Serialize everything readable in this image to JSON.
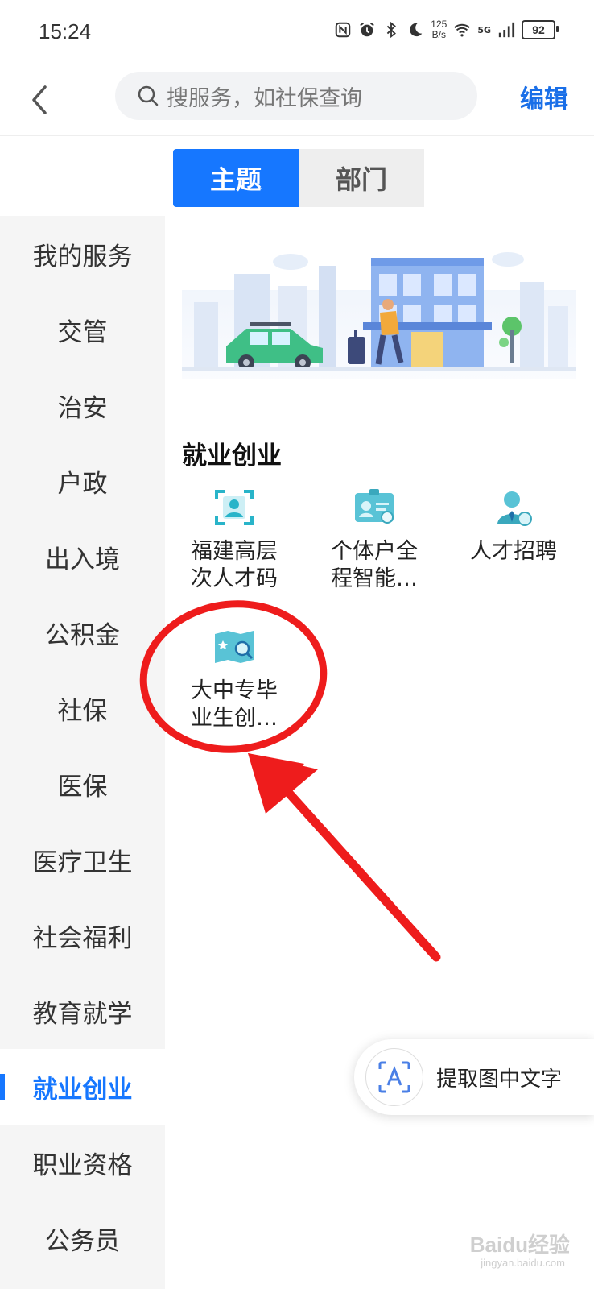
{
  "status_bar": {
    "time": "15:24",
    "speed_value": "125",
    "speed_unit": "B/s",
    "network": "5G",
    "battery": "92",
    "icons": [
      "nfc-icon",
      "alarm-icon",
      "bluetooth-icon",
      "moon-icon",
      "wifi-icon",
      "signal-icon",
      "battery-icon"
    ]
  },
  "header": {
    "back_icon": "chevron-left-icon",
    "search_placeholder": "搜服务，如社保查询",
    "edit_label": "编辑"
  },
  "tabs": [
    {
      "label": "主题",
      "active": true
    },
    {
      "label": "部门",
      "active": false
    }
  ],
  "sidebar": {
    "items": [
      {
        "label": "我的服务",
        "active": false
      },
      {
        "label": "交管",
        "active": false
      },
      {
        "label": "治安",
        "active": false
      },
      {
        "label": "户政",
        "active": false
      },
      {
        "label": "出入境",
        "active": false
      },
      {
        "label": "公积金",
        "active": false
      },
      {
        "label": "社保",
        "active": false
      },
      {
        "label": "医保",
        "active": false
      },
      {
        "label": "医疗卫生",
        "active": false
      },
      {
        "label": "社会福利",
        "active": false
      },
      {
        "label": "教育就学",
        "active": false
      },
      {
        "label": "就业创业",
        "active": true
      },
      {
        "label": "职业资格",
        "active": false
      },
      {
        "label": "公务员",
        "active": false
      }
    ]
  },
  "main": {
    "section_title": "就业创业",
    "services": [
      {
        "line1": "福建高层",
        "line2": "次人才码",
        "icon": "face-scan-icon"
      },
      {
        "line1": "个体户全",
        "line2": "程智能…",
        "icon": "id-card-icon"
      },
      {
        "line1": "人才招聘",
        "line2": "",
        "icon": "recruit-icon"
      },
      {
        "line1": "大中专毕",
        "line2": "业生创…",
        "icon": "book-search-icon"
      }
    ]
  },
  "ocr_button": {
    "label": "提取图中文字",
    "icon": "text-recognition-icon"
  },
  "watermark": {
    "text": "Baidu经验",
    "sub": "jingyan.baidu.com"
  },
  "colors": {
    "accent": "#1677ff",
    "annotation": "#ee1c1c",
    "sidebar_bg": "#f5f5f5"
  }
}
